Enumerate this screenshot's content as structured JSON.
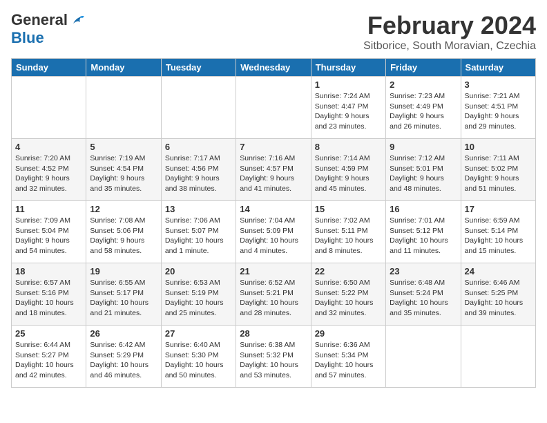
{
  "header": {
    "logo_line1": "General",
    "logo_line2": "Blue",
    "main_title": "February 2024",
    "subtitle": "Sitborice, South Moravian, Czechia"
  },
  "days_of_week": [
    "Sunday",
    "Monday",
    "Tuesday",
    "Wednesday",
    "Thursday",
    "Friday",
    "Saturday"
  ],
  "weeks": [
    [
      {
        "day": "",
        "info": ""
      },
      {
        "day": "",
        "info": ""
      },
      {
        "day": "",
        "info": ""
      },
      {
        "day": "",
        "info": ""
      },
      {
        "day": "1",
        "info": "Sunrise: 7:24 AM\nSunset: 4:47 PM\nDaylight: 9 hours\nand 23 minutes."
      },
      {
        "day": "2",
        "info": "Sunrise: 7:23 AM\nSunset: 4:49 PM\nDaylight: 9 hours\nand 26 minutes."
      },
      {
        "day": "3",
        "info": "Sunrise: 7:21 AM\nSunset: 4:51 PM\nDaylight: 9 hours\nand 29 minutes."
      }
    ],
    [
      {
        "day": "4",
        "info": "Sunrise: 7:20 AM\nSunset: 4:52 PM\nDaylight: 9 hours\nand 32 minutes."
      },
      {
        "day": "5",
        "info": "Sunrise: 7:19 AM\nSunset: 4:54 PM\nDaylight: 9 hours\nand 35 minutes."
      },
      {
        "day": "6",
        "info": "Sunrise: 7:17 AM\nSunset: 4:56 PM\nDaylight: 9 hours\nand 38 minutes."
      },
      {
        "day": "7",
        "info": "Sunrise: 7:16 AM\nSunset: 4:57 PM\nDaylight: 9 hours\nand 41 minutes."
      },
      {
        "day": "8",
        "info": "Sunrise: 7:14 AM\nSunset: 4:59 PM\nDaylight: 9 hours\nand 45 minutes."
      },
      {
        "day": "9",
        "info": "Sunrise: 7:12 AM\nSunset: 5:01 PM\nDaylight: 9 hours\nand 48 minutes."
      },
      {
        "day": "10",
        "info": "Sunrise: 7:11 AM\nSunset: 5:02 PM\nDaylight: 9 hours\nand 51 minutes."
      }
    ],
    [
      {
        "day": "11",
        "info": "Sunrise: 7:09 AM\nSunset: 5:04 PM\nDaylight: 9 hours\nand 54 minutes."
      },
      {
        "day": "12",
        "info": "Sunrise: 7:08 AM\nSunset: 5:06 PM\nDaylight: 9 hours\nand 58 minutes."
      },
      {
        "day": "13",
        "info": "Sunrise: 7:06 AM\nSunset: 5:07 PM\nDaylight: 10 hours\nand 1 minute."
      },
      {
        "day": "14",
        "info": "Sunrise: 7:04 AM\nSunset: 5:09 PM\nDaylight: 10 hours\nand 4 minutes."
      },
      {
        "day": "15",
        "info": "Sunrise: 7:02 AM\nSunset: 5:11 PM\nDaylight: 10 hours\nand 8 minutes."
      },
      {
        "day": "16",
        "info": "Sunrise: 7:01 AM\nSunset: 5:12 PM\nDaylight: 10 hours\nand 11 minutes."
      },
      {
        "day": "17",
        "info": "Sunrise: 6:59 AM\nSunset: 5:14 PM\nDaylight: 10 hours\nand 15 minutes."
      }
    ],
    [
      {
        "day": "18",
        "info": "Sunrise: 6:57 AM\nSunset: 5:16 PM\nDaylight: 10 hours\nand 18 minutes."
      },
      {
        "day": "19",
        "info": "Sunrise: 6:55 AM\nSunset: 5:17 PM\nDaylight: 10 hours\nand 21 minutes."
      },
      {
        "day": "20",
        "info": "Sunrise: 6:53 AM\nSunset: 5:19 PM\nDaylight: 10 hours\nand 25 minutes."
      },
      {
        "day": "21",
        "info": "Sunrise: 6:52 AM\nSunset: 5:21 PM\nDaylight: 10 hours\nand 28 minutes."
      },
      {
        "day": "22",
        "info": "Sunrise: 6:50 AM\nSunset: 5:22 PM\nDaylight: 10 hours\nand 32 minutes."
      },
      {
        "day": "23",
        "info": "Sunrise: 6:48 AM\nSunset: 5:24 PM\nDaylight: 10 hours\nand 35 minutes."
      },
      {
        "day": "24",
        "info": "Sunrise: 6:46 AM\nSunset: 5:25 PM\nDaylight: 10 hours\nand 39 minutes."
      }
    ],
    [
      {
        "day": "25",
        "info": "Sunrise: 6:44 AM\nSunset: 5:27 PM\nDaylight: 10 hours\nand 42 minutes."
      },
      {
        "day": "26",
        "info": "Sunrise: 6:42 AM\nSunset: 5:29 PM\nDaylight: 10 hours\nand 46 minutes."
      },
      {
        "day": "27",
        "info": "Sunrise: 6:40 AM\nSunset: 5:30 PM\nDaylight: 10 hours\nand 50 minutes."
      },
      {
        "day": "28",
        "info": "Sunrise: 6:38 AM\nSunset: 5:32 PM\nDaylight: 10 hours\nand 53 minutes."
      },
      {
        "day": "29",
        "info": "Sunrise: 6:36 AM\nSunset: 5:34 PM\nDaylight: 10 hours\nand 57 minutes."
      },
      {
        "day": "",
        "info": ""
      },
      {
        "day": "",
        "info": ""
      }
    ]
  ]
}
